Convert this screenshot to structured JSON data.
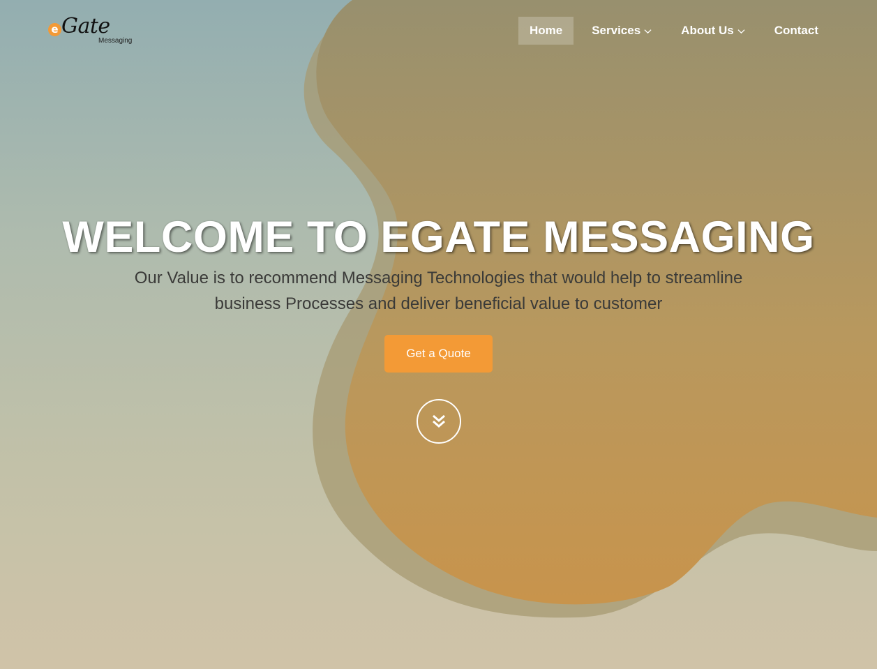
{
  "brand": {
    "logo_mark": "e",
    "logo_name": "Gate",
    "logo_sub": "Messaging"
  },
  "nav": {
    "items": [
      {
        "label": "Home",
        "active": true,
        "dropdown": false
      },
      {
        "label": "Services",
        "active": false,
        "dropdown": true
      },
      {
        "label": "About Us",
        "active": false,
        "dropdown": true
      },
      {
        "label": "Contact",
        "active": false,
        "dropdown": false
      }
    ]
  },
  "hero": {
    "title": "WELCOME TO EGATE MESSAGING",
    "subtitle_line1": "Our Value is to recommend Messaging Technologies that would help to streamline",
    "subtitle_line2": "business Processes and deliver beneficial value to customer",
    "cta_label": "Get a Quote",
    "scroll_icon": "double-chevron-down-icon"
  },
  "colors": {
    "accent": "#f39a36",
    "blob": "#c08d4a",
    "text_dark": "#3a3a38"
  }
}
